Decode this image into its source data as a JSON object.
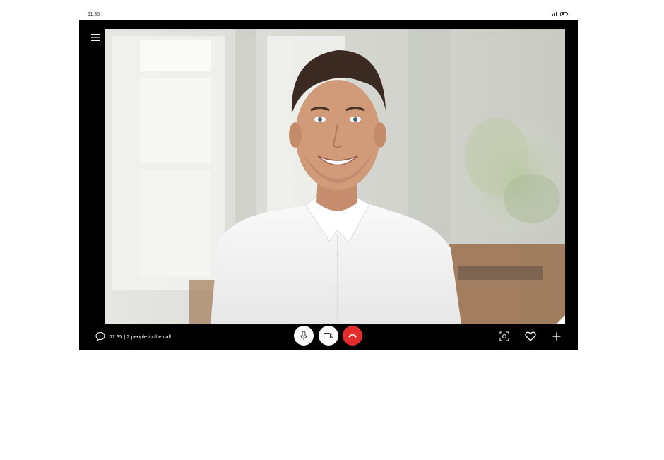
{
  "status_bar": {
    "time": "11:35",
    "signal_icon": "signal-icon",
    "battery_icon": "battery-icon"
  },
  "menu": {
    "icon": "hamburger-menu-icon"
  },
  "video": {
    "subject": "participant-video",
    "accent_background": "#dcdcd6"
  },
  "call": {
    "status_text": "11:35 | 2 people in the call",
    "chat_icon": "chat-bubble-icon"
  },
  "controls": {
    "mic_icon": "microphone-icon",
    "camera_icon": "video-camera-icon",
    "end_call_icon": "phone-hangup-icon",
    "end_call_color": "#e32c2c",
    "snapshot_icon": "snapshot-icon",
    "heart_icon": "heart-icon",
    "add_icon": "plus-icon"
  }
}
